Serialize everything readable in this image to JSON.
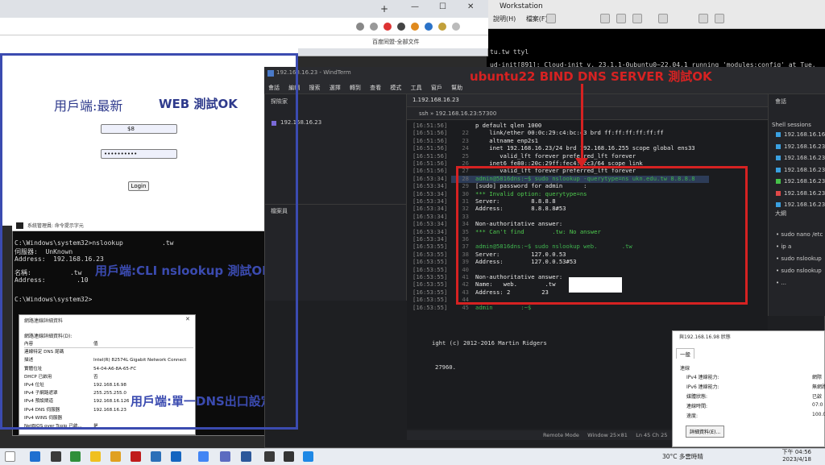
{
  "vmware": {
    "title": "Workstation",
    "menu": [
      "說明(H)",
      "檔案(F)"
    ],
    "console_lines": [
      "tu.tw ttyl",
      "ud-init[891]: Cloud-init v. 23.1.1-0ubuntu0~22.04.1 running 'modules:config' at Tue, 18 Apr 2023"
    ]
  },
  "chrome": {
    "bookmark_text": "百度同盟-全部文件"
  },
  "web": {
    "heading": "用戶端:最新",
    "ok_label": "WEB 測試OK",
    "username_value": "$8",
    "password_value": "••••••••••",
    "login_label": "Login"
  },
  "cmd": {
    "title": "系統管理員: 命令提示字元",
    "lines": [
      "C:\\Windows\\system32>nslookup          .tw",
      "伺服器:  UnKnown",
      "Address:  192.168.16.23",
      "",
      "名稱:          .tw",
      "Address:        .10",
      "",
      "C:\\Windows\\system32>"
    ],
    "annotation": "用戶端:CLI nslookup 測試OK"
  },
  "net_details": {
    "title": "網路連線詳細資料",
    "label": "網路連線詳細資料(D):",
    "headers": [
      "內容",
      "值"
    ],
    "rows": [
      [
        "連線特定 DNS 尾碼",
        ""
      ],
      [
        "描述",
        "Intel(R) 82574L Gigabit Network Connect"
      ],
      [
        "實體位址",
        "54-04-A6-8A-65-FC"
      ],
      [
        "DHCP 已啟用",
        "否"
      ],
      [
        "IPv4 位址",
        "192.168.16.98"
      ],
      [
        "IPv4 子網路遮罩",
        "255.255.255.0"
      ],
      [
        "IPv4 預設閘道",
        "192.168.16.126"
      ],
      [
        "IPv4 DNS 伺服器",
        "192.168.16.23"
      ],
      [
        "IPv4 WINS 伺服器",
        ""
      ],
      [
        "NetBIOS over Tcpip 已啟...",
        "是"
      ]
    ],
    "annotation": "用戶端:單一DNS出口設定"
  },
  "windterm": {
    "title": "192.168.16.23 - WindTerm",
    "menu": [
      "會話",
      "編輯",
      "搜索",
      "選擇",
      "轉到",
      "查看",
      "模式",
      "工具",
      "窗戶",
      "幫助"
    ],
    "explorer_title": "探險家",
    "explorer_item": "192.168.16.23",
    "lower_panel_title": "檔案員",
    "tab_label": "1.192.168.16.23",
    "address": "ssh  »  192.168.16.23:57300",
    "annotation": "ubuntu22 BIND DNS SERVER 測試OK",
    "lines": [
      {
        "ts": "[16:51:56]",
        "n": "",
        "t": "p default qlen 1000",
        "c": ""
      },
      {
        "ts": "[16:51:56]",
        "n": "22",
        "t": "    link/ether 00:0c:29:c4:bc:c3 brd ff:ff:ff:ff:ff:ff",
        "c": ""
      },
      {
        "ts": "[16:51:56]",
        "n": "23",
        "t": "    altname enp2s1",
        "c": ""
      },
      {
        "ts": "[16:51:56]",
        "n": "24",
        "t": "    inet 192.168.16.23/24 brd 192.168.16.255 scope global ens33",
        "c": ""
      },
      {
        "ts": "[16:51:56]",
        "n": "25",
        "t": "       valid_lft forever preferred_lft forever",
        "c": ""
      },
      {
        "ts": "[16:51:56]",
        "n": "26",
        "t": "    inet6 fe80::20c:29ff:fec4:bcc3/64 scope link",
        "c": ""
      },
      {
        "ts": "[16:51:56]",
        "n": "27",
        "t": "       valid_lft forever preferred_lft forever",
        "c": ""
      },
      {
        "ts": "[16:53:34]",
        "n": "28",
        "t": "admin@5816dns:~$ sudo nslookup -querytype=ns ukn.edu.tw 8.8.8.8",
        "c": "prompt"
      },
      {
        "ts": "[16:53:34]",
        "n": "29",
        "t": "[sudo] password for admin      :",
        "c": ""
      },
      {
        "ts": "[16:53:34]",
        "n": "30",
        "t": "*** Invalid option: querytype=ns",
        "c": "err"
      },
      {
        "ts": "[16:53:34]",
        "n": "31",
        "t": "Server:         8.8.8.8",
        "c": ""
      },
      {
        "ts": "[16:53:34]",
        "n": "32",
        "t": "Address:        8.8.8.8#53",
        "c": ""
      },
      {
        "ts": "[16:53:34]",
        "n": "33",
        "t": "",
        "c": ""
      },
      {
        "ts": "[16:53:34]",
        "n": "34",
        "t": "Non-authoritative answer:",
        "c": ""
      },
      {
        "ts": "[16:53:34]",
        "n": "35",
        "t": "*** Can't find        .tw: No answer",
        "c": "err"
      },
      {
        "ts": "[16:53:34]",
        "n": "36",
        "t": "",
        "c": ""
      },
      {
        "ts": "[16:53:55]",
        "n": "37",
        "t": "admin@5816dns:~$ sudo nslookup web.       .tw",
        "c": "prompt"
      },
      {
        "ts": "[16:53:55]",
        "n": "38",
        "t": "Server:         127.0.0.53",
        "c": ""
      },
      {
        "ts": "[16:53:55]",
        "n": "39",
        "t": "Address:        127.0.0.53#53",
        "c": ""
      },
      {
        "ts": "[16:53:55]",
        "n": "40",
        "t": "",
        "c": ""
      },
      {
        "ts": "[16:53:55]",
        "n": "41",
        "t": "Non-authoritative answer:",
        "c": ""
      },
      {
        "ts": "[16:53:55]",
        "n": "42",
        "t": "Name:   web.        .tw",
        "c": ""
      },
      {
        "ts": "[16:53:55]",
        "n": "43",
        "t": "Address: 2         23",
        "c": ""
      },
      {
        "ts": "[16:53:55]",
        "n": "44",
        "t": "",
        "c": ""
      },
      {
        "ts": "[16:53:55]",
        "n": "45",
        "t": "admin        :~$",
        "c": "prompt"
      }
    ],
    "lower_lines": [
      "ight (c) 2012-2016 Martin Ridgers",
      "27960."
    ],
    "status": "Remote Mode     Window 25×81     Ln 45 Ch 25",
    "right_panel": {
      "title": "會話",
      "group": "Shell sessions",
      "sessions": [
        {
          "label": "192.168.16.16",
          "color": "#3aa0e0"
        },
        {
          "label": "192.168.16.23",
          "color": "#3aa0e0"
        },
        {
          "label": "192.168.16.23",
          "color": "#3aa0e0"
        },
        {
          "label": "192.168.16.23",
          "color": "#3aa0e0"
        },
        {
          "label": "192.168.16.23",
          "color": "#46c14a"
        },
        {
          "label": "192.168.16.23",
          "color": "#e04848"
        },
        {
          "label": "192.168.16.23",
          "color": "#3aa0e0"
        }
      ],
      "history_title": "大綱",
      "history": [
        "sudo nano /etc",
        "ip a",
        "sudo nslookup",
        "sudo nslookup",
        "..."
      ]
    }
  },
  "ipv4_status": {
    "title": "與192.168.16.98 狀態",
    "tab": "一般",
    "section": "連線",
    "rows": [
      {
        "k": "IPv4 連線能力:",
        "v": "網際"
      },
      {
        "k": "IPv6 連線能力:",
        "v": "無網路"
      },
      {
        "k": "媒體狀態:",
        "v": "已啟"
      },
      {
        "k": "連線時間:",
        "v": "07:0"
      },
      {
        "k": "速度:",
        "v": "100.0 M"
      }
    ],
    "details_button": "詳細資料(E)..."
  },
  "taskbar": {
    "weather": "30°C  多雲時晴",
    "time": "下午 04:56",
    "date": "2023/4/18",
    "icon_colors": [
      "#ffffff",
      "#1f6fd0",
      "#3a3a3a",
      "#2f8f3a",
      "#f0c020",
      "#e0a020",
      "#c01c1c",
      "#2b6fb8",
      "#1565c0",
      "#4285f4",
      "#5c6bc0",
      "#2b579a",
      "#3a3a3a",
      "#333333",
      "#1e88e5"
    ]
  },
  "colors": {
    "annotation_blue": "#3b4bb0",
    "annotation_red": "#d62222",
    "terminal_bg": "#1b1c1f"
  }
}
